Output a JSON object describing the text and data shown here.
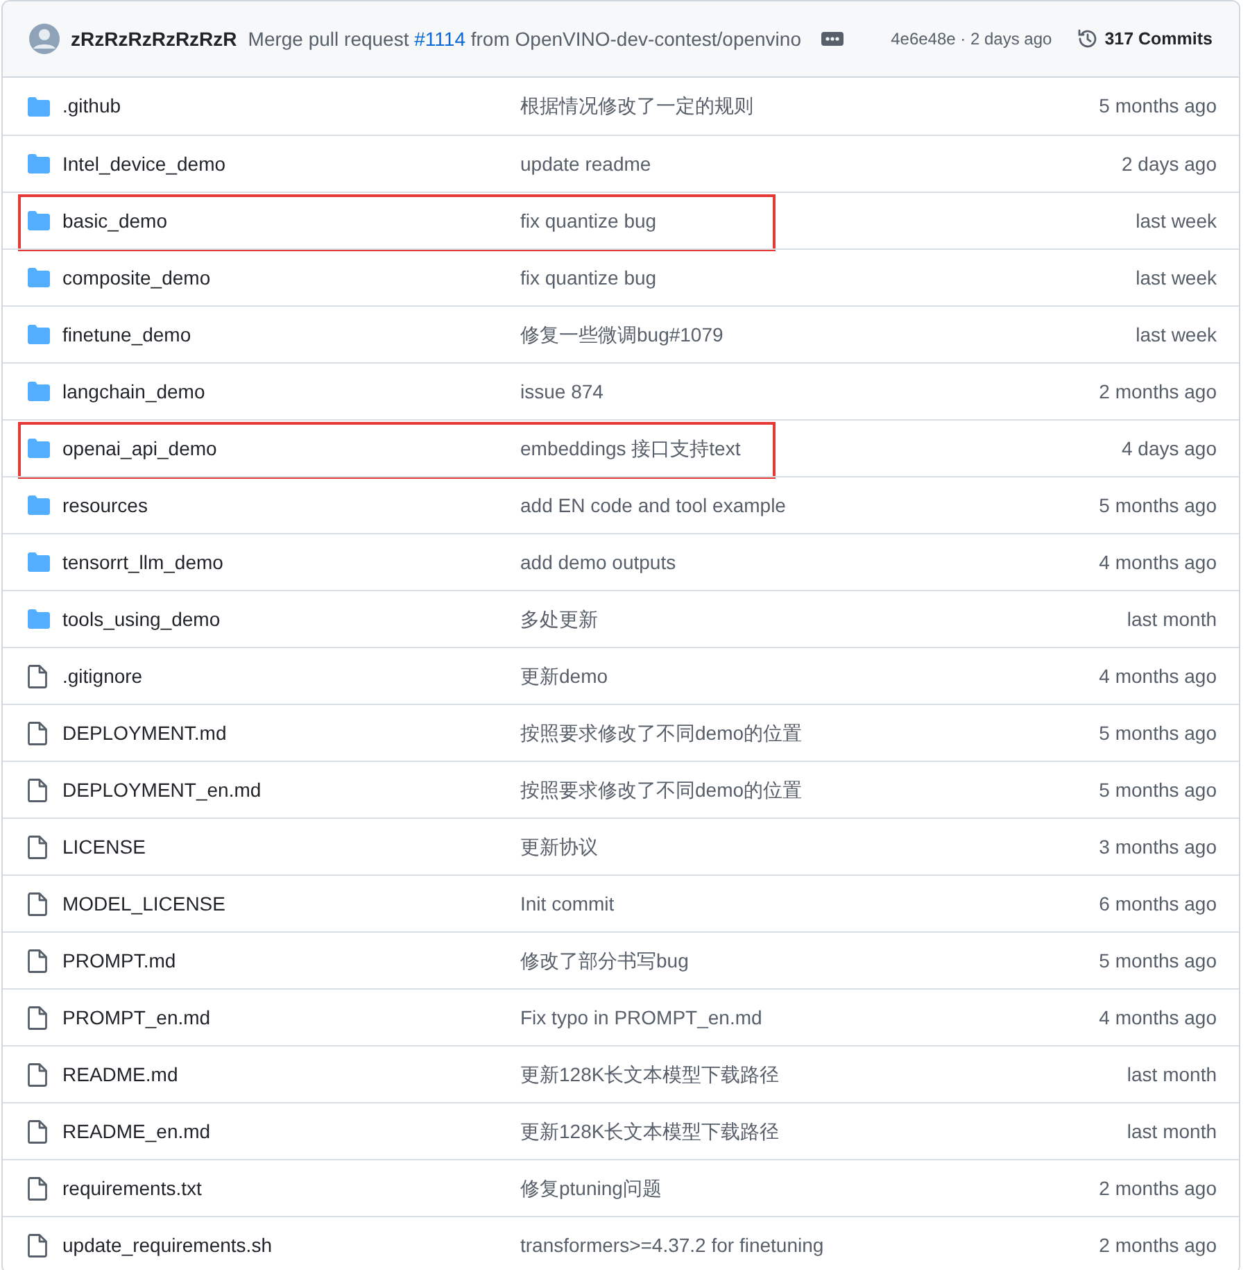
{
  "latest_commit": {
    "author": "zRzRzRzRzRzRzR",
    "message_before": "Merge pull request",
    "pr_link": "#1114",
    "message_after": "from OpenVINO-dev-contest/openvino",
    "sha_date": "4e6e48e · 2 days ago",
    "commits": "317 Commits"
  },
  "files": [
    {
      "kind": "folder",
      "name": ".github",
      "message": "根据情况修改了一定的规则",
      "date": "5 months ago",
      "highlighted": false
    },
    {
      "kind": "folder",
      "name": "Intel_device_demo",
      "message": "update readme",
      "date": "2 days ago",
      "highlighted": false
    },
    {
      "kind": "folder",
      "name": "basic_demo",
      "message": "fix quantize bug",
      "date": "last week",
      "highlighted": true
    },
    {
      "kind": "folder",
      "name": "composite_demo",
      "message": "fix quantize bug",
      "date": "last week",
      "highlighted": false
    },
    {
      "kind": "folder",
      "name": "finetune_demo",
      "message": "修复一些微调bug#1079",
      "date": "last week",
      "highlighted": false
    },
    {
      "kind": "folder",
      "name": "langchain_demo",
      "message": "issue 874",
      "date": "2 months ago",
      "highlighted": false
    },
    {
      "kind": "folder",
      "name": "openai_api_demo",
      "message": "embeddings 接口支持text",
      "date": "4 days ago",
      "highlighted": true
    },
    {
      "kind": "folder",
      "name": "resources",
      "message": "add EN code and tool example",
      "date": "5 months ago",
      "highlighted": false
    },
    {
      "kind": "folder",
      "name": "tensorrt_llm_demo",
      "message": "add demo outputs",
      "date": "4 months ago",
      "highlighted": false
    },
    {
      "kind": "folder",
      "name": "tools_using_demo",
      "message": "多处更新",
      "date": "last month",
      "highlighted": false
    },
    {
      "kind": "file",
      "name": ".gitignore",
      "message": "更新demo",
      "date": "4 months ago",
      "highlighted": false
    },
    {
      "kind": "file",
      "name": "DEPLOYMENT.md",
      "message": "按照要求修改了不同demo的位置",
      "date": "5 months ago",
      "highlighted": false
    },
    {
      "kind": "file",
      "name": "DEPLOYMENT_en.md",
      "message": "按照要求修改了不同demo的位置",
      "date": "5 months ago",
      "highlighted": false
    },
    {
      "kind": "file",
      "name": "LICENSE",
      "message": "更新协议",
      "date": "3 months ago",
      "highlighted": false
    },
    {
      "kind": "file",
      "name": "MODEL_LICENSE",
      "message": "Init commit",
      "date": "6 months ago",
      "highlighted": false
    },
    {
      "kind": "file",
      "name": "PROMPT.md",
      "message": "修改了部分书写bug",
      "date": "5 months ago",
      "highlighted": false
    },
    {
      "kind": "file",
      "name": "PROMPT_en.md",
      "message": "Fix typo in PROMPT_en.md",
      "date": "4 months ago",
      "highlighted": false
    },
    {
      "kind": "file",
      "name": "README.md",
      "message": "更新128K长文本模型下载路径",
      "date": "last month",
      "highlighted": false
    },
    {
      "kind": "file",
      "name": "README_en.md",
      "message": "更新128K长文本模型下载路径",
      "date": "last month",
      "highlighted": false
    },
    {
      "kind": "file",
      "name": "requirements.txt",
      "message": "修复ptuning问题",
      "date": "2 months ago",
      "highlighted": false
    },
    {
      "kind": "file",
      "name": "update_requirements.sh",
      "message": "transformers>=4.37.2 for finetuning",
      "date": "2 months ago",
      "highlighted": false
    }
  ]
}
